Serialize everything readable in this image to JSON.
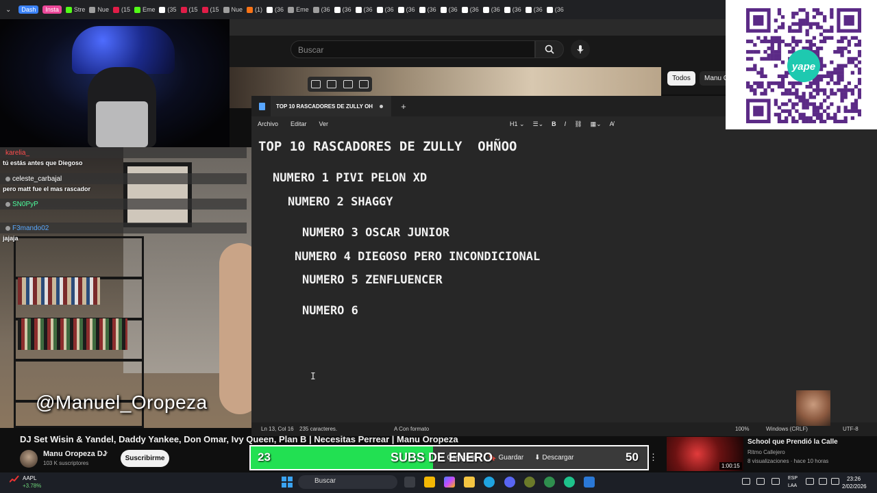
{
  "browser": {
    "tabs": [
      {
        "label": "Dash",
        "color": "#3b82f6",
        "pill": true
      },
      {
        "label": "Insta",
        "color": "#ec4899",
        "pill": true
      },
      {
        "label": "Stre",
        "color": "#53fc18"
      },
      {
        "label": "Nue",
        "color": "#9e9e9e"
      },
      {
        "label": "(15",
        "color": "#e11d48"
      },
      {
        "label": "Eme",
        "color": "#53fc18"
      },
      {
        "label": "(35",
        "color": "#ffffff"
      },
      {
        "label": "(15",
        "color": "#e11d48"
      },
      {
        "label": "(15",
        "color": "#e11d48"
      },
      {
        "label": "Nue",
        "color": "#9e9e9e"
      },
      {
        "label": "(1)",
        "color": "#f97316"
      },
      {
        "label": "(36",
        "color": "#ffffff"
      },
      {
        "label": "Eme",
        "color": "#9e9e9e"
      },
      {
        "label": "(36",
        "color": "#9e9e9e"
      },
      {
        "label": "(36",
        "color": "#ffffff"
      },
      {
        "label": "(36",
        "color": "#ffffff"
      },
      {
        "label": "(36",
        "color": "#ffffff"
      },
      {
        "label": "(36",
        "color": "#ffffff"
      },
      {
        "label": "(36",
        "color": "#ffffff"
      },
      {
        "label": "(36",
        "color": "#ffffff"
      },
      {
        "label": "(36",
        "color": "#ffffff"
      },
      {
        "label": "(36",
        "color": "#ffffff"
      },
      {
        "label": "(36",
        "color": "#ffffff"
      },
      {
        "label": "(36",
        "color": "#ffffff"
      },
      {
        "label": "(36",
        "color": "#ffffff"
      }
    ]
  },
  "youtube": {
    "search_placeholder": "Buscar",
    "chips": {
      "todos": "Todos",
      "manu": "Manu O"
    },
    "video_title": "DJ Set Wisin & Yandel, Daddy Yankee, Don Omar, Ivy Queen, Plan B | Necesitas Perrear | Manu Oropeza",
    "channel_name": "Manu Oropeza DJ",
    "verified": "✔",
    "subscribers": "103 K suscriptores",
    "subscribe_label": "Suscribirme",
    "actions": {
      "share": "Compartir",
      "save": "Guardar",
      "download": "Descargar"
    },
    "suggested": {
      "title": "School que Prendió la Calle",
      "channel": "Ritmo Callejero",
      "meta": "8 visualizaciones · hace 10 horas",
      "duration": "1:00:15"
    }
  },
  "overlay": {
    "handle": "@Manuel_Oropeza",
    "chat": [
      {
        "user": "karelia_",
        "text": "tú estás antes que Diegoso",
        "color": "#ff4d4d"
      },
      {
        "user": "celeste_carbajal",
        "text": "pero matt fue el mas rascador",
        "color": "#ffffff"
      },
      {
        "user": "SN0PyP",
        "text": "",
        "color": "#4dff9e"
      },
      {
        "user": "F3mando02",
        "text": "jajaja",
        "color": "#5aa9ff"
      }
    ],
    "goal": {
      "current": "23",
      "label": "SUBS DE ENERO",
      "target": "50",
      "progress": 0.46
    }
  },
  "notepad": {
    "tab_title": "TOP 10 RASCADORES DE ZULLY OH",
    "menus": [
      "Archivo",
      "Editar",
      "Ver"
    ],
    "heading_select": "H1",
    "lines": [
      "TOP 10 RASCADORES DE ZULLY  OHÑOO",
      "NUMERO 1 PIVI PELON XD",
      "NUMERO 2 SHAGGY",
      "NUMERO 3 OSCAR JUNIOR",
      "NUMERO 4 DIEGOSO PERO INCONDICIONAL",
      "NUMERO 5 ZENFLUENCER",
      "NUMERO 6"
    ],
    "status": {
      "position": "Ln 13, Col 16",
      "chars": "235 caracteres.",
      "format": "Con formato",
      "zoom": "100%",
      "line_ending": "Windows (CRLF)",
      "encoding": "UTF-8"
    }
  },
  "qr": {
    "brand": "yape"
  },
  "taskbar": {
    "stock_name": "AAPL",
    "stock_change": "+3.78%",
    "search": "Buscar",
    "lang1": "ESP",
    "lang2": "LAA",
    "time": "23:26",
    "date": "2/02/2026"
  }
}
